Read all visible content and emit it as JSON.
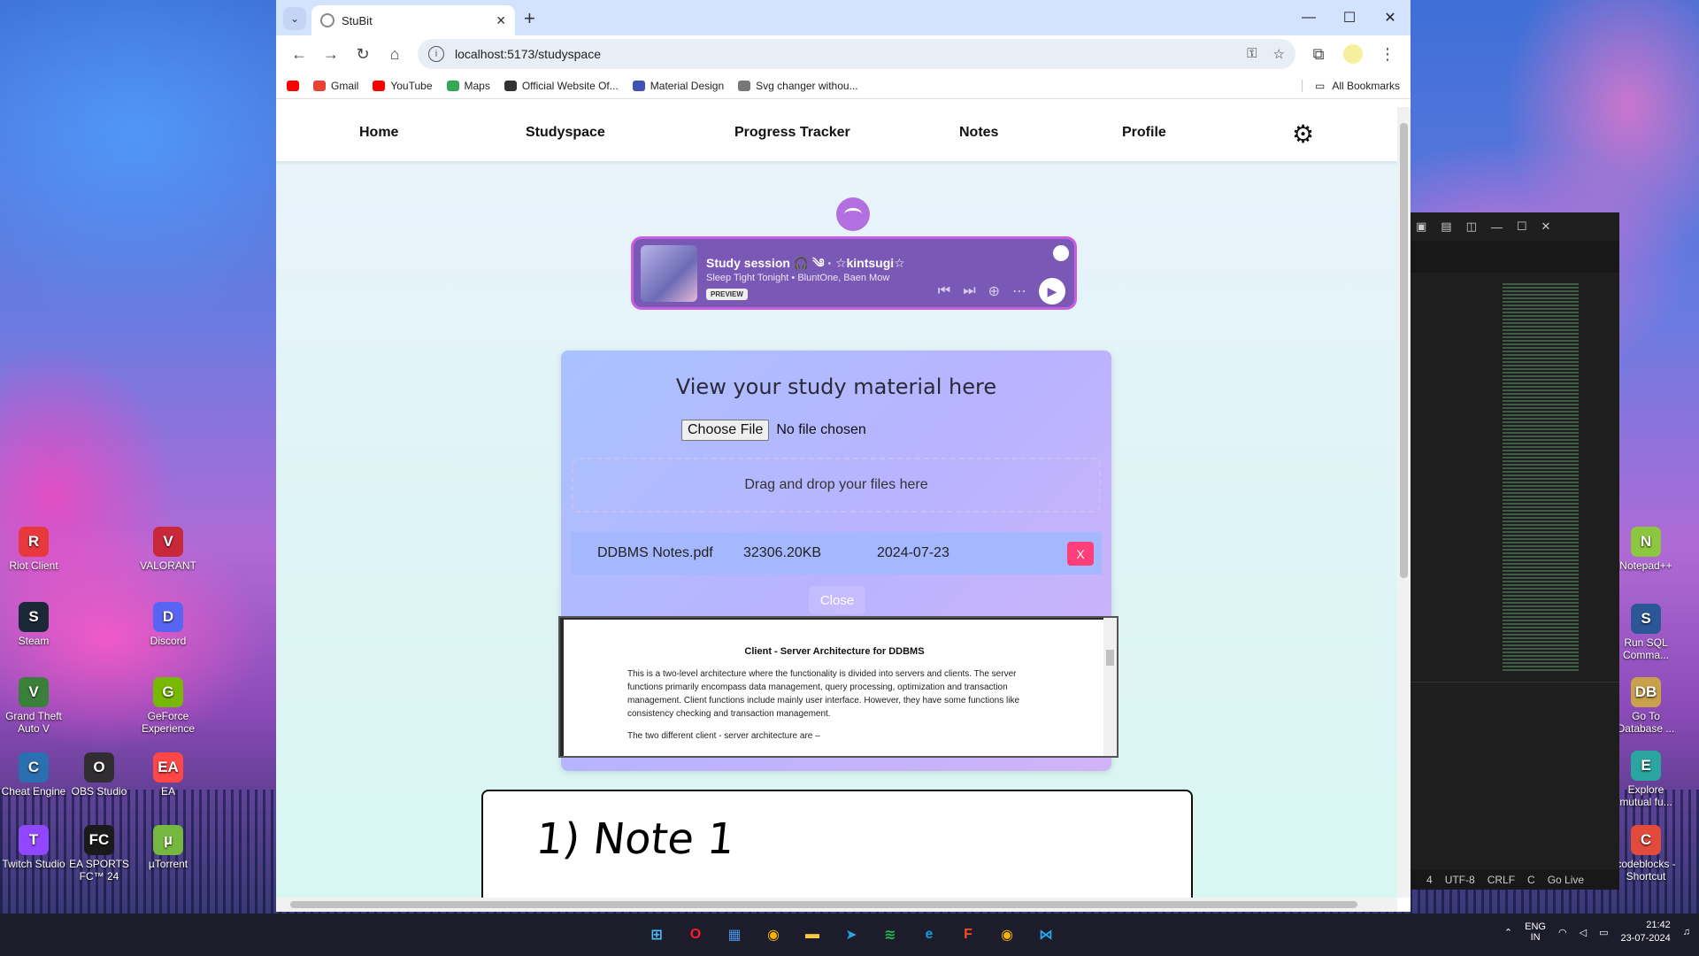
{
  "desktop": {
    "icons": [
      {
        "label": "Riot Client",
        "glyph": "R",
        "color": "#e8383d"
      },
      {
        "label": "VALORANT",
        "glyph": "V",
        "color": "#c8283a"
      },
      {
        "label": "Steam",
        "glyph": "S",
        "color": "#1b2838"
      },
      {
        "label": "Discord",
        "glyph": "D",
        "color": "#5865f2"
      },
      {
        "label": "Grand Theft Auto V",
        "glyph": "V",
        "color": "#3a7f3a"
      },
      {
        "label": "GeForce Experience",
        "glyph": "G",
        "color": "#76b900"
      },
      {
        "label": "Cheat Engine",
        "glyph": "C",
        "color": "#2a6fb0"
      },
      {
        "label": "OBS Studio",
        "glyph": "O",
        "color": "#302e31"
      },
      {
        "label": "EA",
        "glyph": "EA",
        "color": "#ff4747"
      },
      {
        "label": "Twitch Studio",
        "glyph": "T",
        "color": "#9146ff"
      },
      {
        "label": "EA SPORTS FC™ 24",
        "glyph": "FC",
        "color": "#1a1a1a"
      },
      {
        "label": "µTorrent",
        "glyph": "µ",
        "color": "#76b83f"
      },
      {
        "label": "Notepad++",
        "glyph": "N",
        "color": "#8dc63f"
      },
      {
        "label": "Run SQL Comma...",
        "glyph": "S",
        "color": "#2b5797"
      },
      {
        "label": "Go To Database ...",
        "glyph": "DB",
        "color": "#c8a14a"
      },
      {
        "label": "Explore mutual fu...",
        "glyph": "E",
        "color": "#2aa5a0"
      },
      {
        "label": "codeblocks - Shortcut",
        "glyph": "C",
        "color": "#e24a3b"
      }
    ]
  },
  "vscode": {
    "status": [
      "4",
      "UTF-8",
      "CRLF",
      "C",
      "Go Live"
    ]
  },
  "browser": {
    "tab_title": "StuBit",
    "url": "localhost:5173/studyspace",
    "bookmarks": [
      {
        "label": "",
        "color": "#ff0000"
      },
      {
        "label": "Gmail",
        "color": "#ea4335"
      },
      {
        "label": "YouTube",
        "color": "#ff0000"
      },
      {
        "label": "Maps",
        "color": "#34a853"
      },
      {
        "label": "Official Website Of...",
        "color": "#333333"
      },
      {
        "label": "Material Design",
        "color": "#3f51b5"
      },
      {
        "label": "Svg changer withou...",
        "color": "#777777"
      }
    ],
    "all_bookmarks": "All Bookmarks"
  },
  "site": {
    "nav": [
      "Home",
      "Studyspace",
      "Progress Tracker",
      "Notes",
      "Profile"
    ],
    "player": {
      "title": "Study session 🎧 ༄ · ☆kintsugi☆",
      "subtitle": "Sleep Tight Tonight  •  BluntOne, Baen Mow",
      "badge": "PREVIEW"
    },
    "card": {
      "heading": "View your study material here",
      "choose_file": "Choose File",
      "no_file": "No file chosen",
      "dropzone": "Drag and drop your files here",
      "file": {
        "name": "DDBMS Notes.pdf",
        "size": "32306.20KB",
        "date": "2024-07-23",
        "remove": "X"
      },
      "close": "Close"
    },
    "pdf": {
      "title": "Client - Server Architecture for DDBMS",
      "body": "This is a two-level architecture where the functionality is divided into servers and clients. The server functions primarily encompass data management, query processing, optimization and transaction management. Client functions include mainly user interface. However, they have some functions like consistency checking and transaction management.",
      "line": "The two different client - server architecture are –"
    },
    "note_ink": "1) Note 1"
  },
  "taskbar": {
    "apps": [
      {
        "glyph": "⊞",
        "color": "#4cc2ff"
      },
      {
        "glyph": "O",
        "color": "#ff1b2d"
      },
      {
        "glyph": "▦",
        "color": "#4a90e2"
      },
      {
        "glyph": "◉",
        "color": "#f4b400"
      },
      {
        "glyph": "▬",
        "color": "#f7c948"
      },
      {
        "glyph": "➤",
        "color": "#2aa3e0"
      },
      {
        "glyph": "≋",
        "color": "#1db954"
      },
      {
        "glyph": "e",
        "color": "#0f9bd7"
      },
      {
        "glyph": "F",
        "color": "#f24e1e"
      },
      {
        "glyph": "◉",
        "color": "#f4b400"
      },
      {
        "glyph": "⋈",
        "color": "#23a9f2"
      }
    ],
    "lang": "ENG",
    "region": "IN",
    "time": "21:42",
    "date": "23-07-2024"
  }
}
